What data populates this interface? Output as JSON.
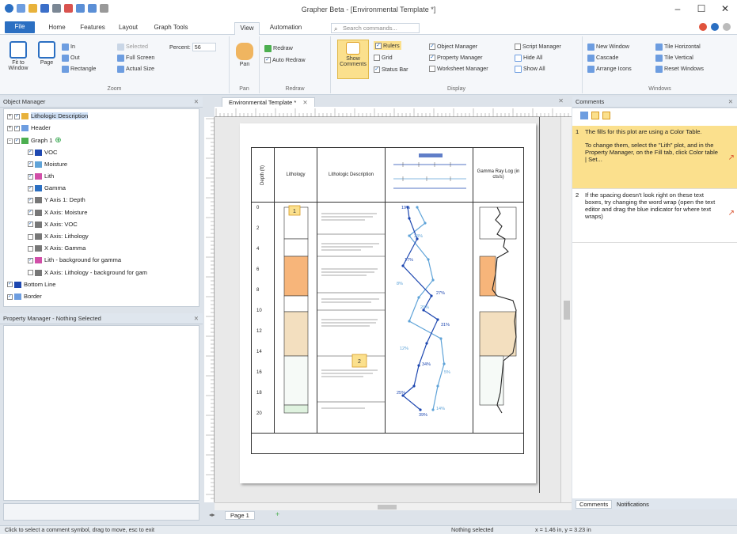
{
  "window": {
    "title": "Grapher Beta - [Environmental Template *]",
    "controls": [
      "–",
      "☐",
      "✕"
    ]
  },
  "ribbon_tabs": [
    {
      "label": "File"
    },
    {
      "label": "Home"
    },
    {
      "label": "Features"
    },
    {
      "label": "Layout"
    },
    {
      "label": "Graph Tools"
    },
    {
      "label": "View"
    },
    {
      "label": "Automation"
    }
  ],
  "search": {
    "placeholder": "Search commands..."
  },
  "ribbon": {
    "zoom": {
      "fit_to_window": "Fit to Window",
      "page": "Page",
      "in": "In",
      "out": "Out",
      "rectangle": "Rectangle",
      "selected": "Selected",
      "full_screen": "Full Screen",
      "actual_size": "Actual Size",
      "percent_label": "Percent:",
      "percent_value": "56",
      "group": "Zoom"
    },
    "pan": {
      "pan": "Pan",
      "group": "Pan"
    },
    "redraw": {
      "redraw": "Redraw",
      "auto_redraw": "Auto Redraw",
      "group": "Redraw"
    },
    "display": {
      "show_comments": "Show Comments",
      "rulers": "Rulers",
      "grid": "Grid",
      "status_bar": "Status Bar",
      "object_manager": "Object Manager",
      "property_manager": "Property Manager",
      "worksheet_manager": "Worksheet Manager",
      "script_manager": "Script Manager",
      "hide_all": "Hide All",
      "show_all": "Show All",
      "group": "Display"
    },
    "windows": {
      "new_window": "New Window",
      "cascade": "Cascade",
      "arrange_icons": "Arrange Icons",
      "tile_horizontal": "Tile Horizontal",
      "tile_vertical": "Tile Vertical",
      "reset_windows": "Reset Windows",
      "group": "Windows"
    }
  },
  "object_manager": {
    "title": "Object Manager",
    "items": [
      {
        "label": "Lithologic Description",
        "level": 0,
        "expander": "+",
        "checked": true
      },
      {
        "label": "Header",
        "level": 0,
        "expander": "+",
        "checked": true
      },
      {
        "label": "Graph 1",
        "level": 0,
        "expander": "-",
        "checked": true
      },
      {
        "label": "VOC",
        "level": 1,
        "checked": true
      },
      {
        "label": "Moisture",
        "level": 1,
        "checked": true
      },
      {
        "label": "Lith",
        "level": 1,
        "checked": true
      },
      {
        "label": "Gamma",
        "level": 1,
        "checked": true
      },
      {
        "label": "Y Axis 1: Depth",
        "level": 1,
        "checked": true
      },
      {
        "label": "X Axis: Moisture",
        "level": 1,
        "checked": true
      },
      {
        "label": "X Axis: VOC",
        "level": 1,
        "checked": true
      },
      {
        "label": "X Axis: Lithology",
        "level": 1,
        "checked": false
      },
      {
        "label": "X Axis: Gamma",
        "level": 1,
        "checked": false
      },
      {
        "label": "Lith - background for gamma",
        "level": 1,
        "checked": true
      },
      {
        "label": "X Axis: Lithology - background for gam",
        "level": 1,
        "checked": false
      },
      {
        "label": "Bottom Line",
        "level": 0,
        "checked": true
      },
      {
        "label": "Border",
        "level": 0,
        "checked": true
      }
    ]
  },
  "property_manager": {
    "title": "Property Manager - Nothing Selected"
  },
  "document": {
    "tab_label": "Environmental Template *",
    "page_tab": "Page 1",
    "log": {
      "headers": {
        "depth": "Depth (ft)",
        "lithology": "Lithology",
        "description": "Lithologic Description",
        "gamma": "Gamma Ray Log (in cts/s)"
      },
      "depth_ticks": [
        "0",
        "2",
        "4",
        "6",
        "8",
        "10",
        "12",
        "14",
        "16",
        "18",
        "20"
      ],
      "voc_labels": [
        "19%",
        "23%",
        "17%",
        "8%",
        "27%",
        "20%",
        "31%",
        "12%",
        "34%",
        "5%",
        "25%",
        "14%",
        "39%"
      ]
    }
  },
  "comments_panel": {
    "title": "Comments",
    "comments": [
      {
        "num": "1",
        "lines": [
          "The fills for this plot are using a Color Table.",
          "To change them, select the \"Lith\" plot, and in the Property Manager, on the Fill tab, click Color table | Set..."
        ]
      },
      {
        "num": "2",
        "lines": [
          "If the spacing doesn't look right on these text boxes, try changing the word wrap (open the text editor and drag the blue indicator for where text wraps)"
        ]
      }
    ],
    "tabs": [
      "Comments",
      "Notifications"
    ]
  },
  "status": {
    "hint": "Click to select a comment symbol, drag to move, esc to exit",
    "selection": "Nothing selected",
    "coords": "x = 1.46 in, y = 3.23 in"
  },
  "colors": {
    "file_tab": "#2b6fc2",
    "highlight": "#fbe08d",
    "lith_sand": "#f7b57a",
    "lith_silt": "#f3dfbf",
    "voc_line": "#1d47b0",
    "moisture_line": "#5fa3d8"
  }
}
